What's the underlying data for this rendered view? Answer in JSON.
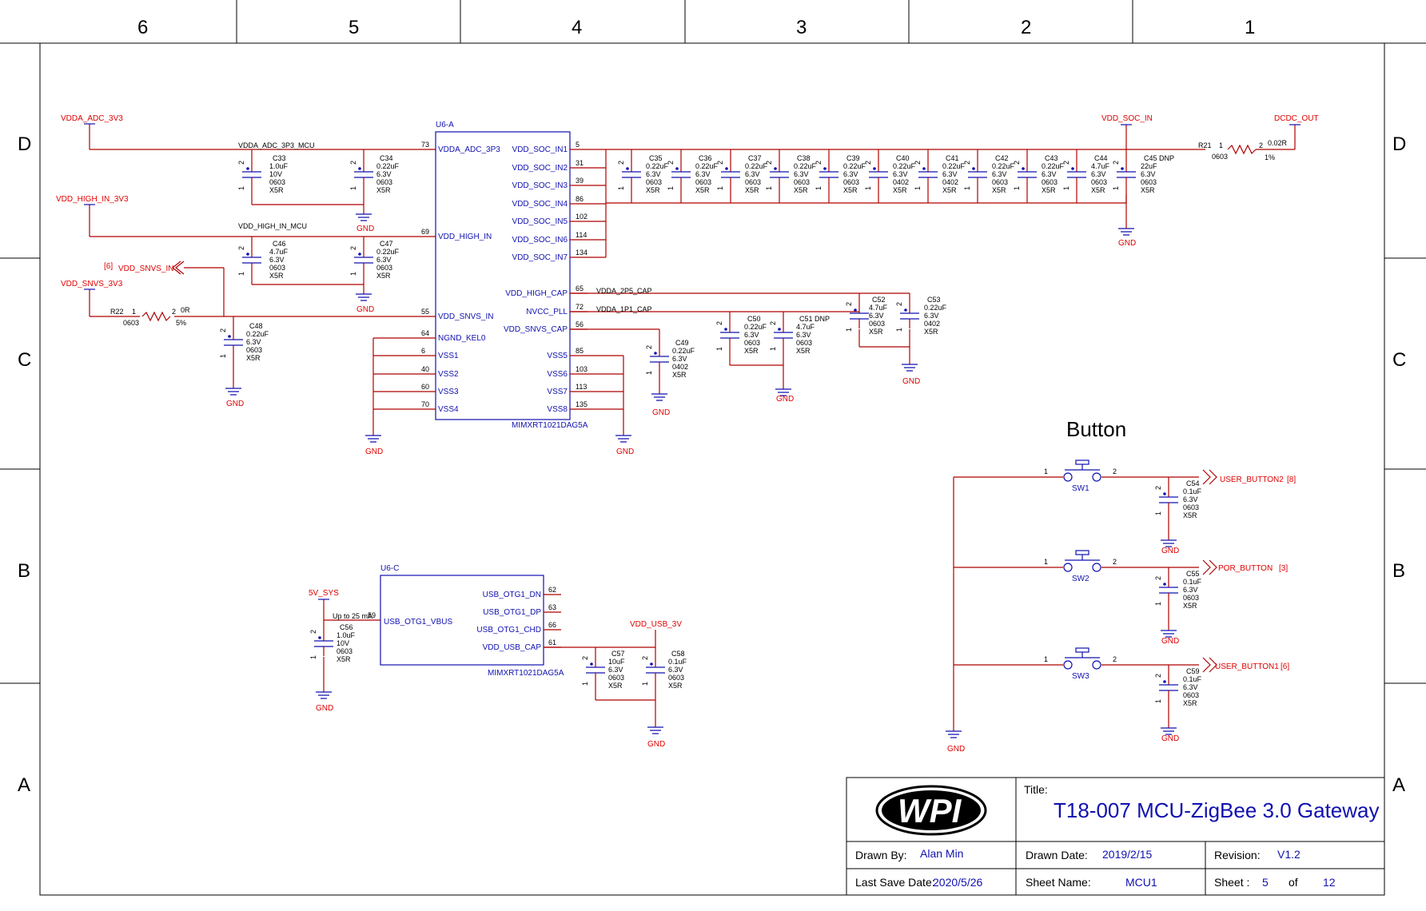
{
  "zones": {
    "columns": [
      "6",
      "5",
      "4",
      "3",
      "2",
      "1"
    ],
    "rows": [
      "D",
      "C",
      "B",
      "A"
    ]
  },
  "nets": {
    "vdda_adc": "VDDA_ADC_3V3",
    "vdda_adc_mcu": "VDDA_ADC_3P3_MCU",
    "vdd_high_in": "VDD_HIGH_IN_3V3",
    "vdd_high_in_mcu": "VDD_HIGH_IN_MCU",
    "vdd_snvs_in": "VDD_SNVS_IN",
    "vdd_snvs_in_ref": "[6]",
    "vdd_snvs_3v3": "VDD_SNVS_3V3",
    "vdd_soc_in": "VDD_SOC_IN",
    "dcdc_out": "DCDC_OUT",
    "vdda_2p5": "VDDA_2P5_CAP",
    "vdda_1p1": "VDDA_1P1_CAP",
    "v5_sys": "5V_SYS",
    "vdd_usb_3v": "VDD_USB_3V",
    "gnd": "GND",
    "user_button2": "USER_BUTTON2",
    "user_button2_ref": "[8]",
    "por_button": "POR_BUTTON",
    "por_button_ref": "[3]",
    "user_button1": "USER_BUTTON1",
    "user_button1_ref": "[6]",
    "usb_note": "Up to 25 mA"
  },
  "u6a": {
    "ref": "U6-A",
    "part": "MIMXRT1021DAG5A",
    "left_pins": [
      {
        "num": "73",
        "name": "VDDA_ADC_3P3"
      },
      {
        "num": "69",
        "name": "VDD_HIGH_IN"
      },
      {
        "num": "55",
        "name": "VDD_SNVS_IN"
      },
      {
        "num": "64",
        "name": "NGND_KEL0"
      },
      {
        "num": "6",
        "name": "VSS1"
      },
      {
        "num": "40",
        "name": "VSS2"
      },
      {
        "num": "60",
        "name": "VSS3"
      },
      {
        "num": "70",
        "name": "VSS4"
      }
    ],
    "right_pins": [
      {
        "num": "5",
        "name": "VDD_SOC_IN1"
      },
      {
        "num": "31",
        "name": "VDD_SOC_IN2"
      },
      {
        "num": "39",
        "name": "VDD_SOC_IN3"
      },
      {
        "num": "86",
        "name": "VDD_SOC_IN4"
      },
      {
        "num": "102",
        "name": "VDD_SOC_IN5"
      },
      {
        "num": "114",
        "name": "VDD_SOC_IN6"
      },
      {
        "num": "134",
        "name": "VDD_SOC_IN7"
      },
      {
        "num": "65",
        "name": "VDD_HIGH_CAP"
      },
      {
        "num": "72",
        "name": "NVCC_PLL"
      },
      {
        "num": "56",
        "name": "VDD_SNVS_CAP"
      },
      {
        "num": "85",
        "name": "VSS5"
      },
      {
        "num": "103",
        "name": "VSS6"
      },
      {
        "num": "113",
        "name": "VSS7"
      },
      {
        "num": "135",
        "name": "VSS8"
      }
    ]
  },
  "u6c": {
    "ref": "U6-C",
    "part": "MIMXRT1021DAG5A",
    "left_pins": [
      {
        "num": "59",
        "name": "USB_OTG1_VBUS"
      }
    ],
    "right_pins": [
      {
        "num": "62",
        "name": "USB_OTG1_DN"
      },
      {
        "num": "63",
        "name": "USB_OTG1_DP"
      },
      {
        "num": "66",
        "name": "USB_OTG1_CHD"
      },
      {
        "num": "61",
        "name": "VDD_USB_CAP"
      }
    ]
  },
  "caps_left": [
    {
      "ref": "C33",
      "val": "1.0uF",
      "v": "10V",
      "pkg": "0603",
      "d": "X5R"
    },
    {
      "ref": "C34",
      "val": "0.22uF",
      "v": "6.3V",
      "pkg": "0603",
      "d": "X5R"
    },
    {
      "ref": "C46",
      "val": "4.7uF",
      "v": "6.3V",
      "pkg": "0603",
      "d": "X5R"
    },
    {
      "ref": "C47",
      "val": "0.22uF",
      "v": "6.3V",
      "pkg": "0603",
      "d": "X5R"
    },
    {
      "ref": "C48",
      "val": "0.22uF",
      "v": "6.3V",
      "pkg": "0603",
      "d": "X5R"
    }
  ],
  "soc_caps": [
    {
      "ref": "C35",
      "val": "0.22uF",
      "v": "6.3V",
      "pkg": "0603",
      "d": "X5R"
    },
    {
      "ref": "C36",
      "val": "0.22uF",
      "v": "6.3V",
      "pkg": "0603",
      "d": "X5R"
    },
    {
      "ref": "C37",
      "val": "0.22uF",
      "v": "6.3V",
      "pkg": "0603",
      "d": "X5R"
    },
    {
      "ref": "C38",
      "val": "0.22uF",
      "v": "6.3V",
      "pkg": "0603",
      "d": "X5R"
    },
    {
      "ref": "C39",
      "val": "0.22uF",
      "v": "6.3V",
      "pkg": "0603",
      "d": "X5R"
    },
    {
      "ref": "C40",
      "val": "0.22uF",
      "v": "6.3V",
      "pkg": "0402",
      "d": "X5R"
    },
    {
      "ref": "C41",
      "val": "0.22uF",
      "v": "6.3V",
      "pkg": "0402",
      "d": "X5R"
    },
    {
      "ref": "C42",
      "val": "0.22uF",
      "v": "6.3V",
      "pkg": "0603",
      "d": "X5R"
    },
    {
      "ref": "C43",
      "val": "0.22uF",
      "v": "6.3V",
      "pkg": "0603",
      "d": "X5R"
    },
    {
      "ref": "C44",
      "val": "4.7uF",
      "v": "6.3V",
      "pkg": "0603",
      "d": "X5R"
    },
    {
      "ref": "C45 DNP",
      "val": "22uF",
      "v": "6.3V",
      "pkg": "0603",
      "d": "X5R"
    }
  ],
  "mid_caps": [
    {
      "ref": "C49",
      "val": "0.22uF",
      "v": "6.3V",
      "pkg": "0402",
      "d": "X5R"
    },
    {
      "ref": "C50",
      "val": "0.22uF",
      "v": "6.3V",
      "pkg": "0603",
      "d": "X5R"
    },
    {
      "ref": "C51 DNP",
      "val": "4.7uF",
      "v": "6.3V",
      "pkg": "0603",
      "d": "X5R"
    },
    {
      "ref": "C52",
      "val": "4.7uF",
      "v": "6.3V",
      "pkg": "0603",
      "d": "X5R"
    },
    {
      "ref": "C53",
      "val": "0.22uF",
      "v": "6.3V",
      "pkg": "0402",
      "d": "X5R"
    }
  ],
  "usb_caps": [
    {
      "ref": "C56",
      "val": "1.0uF",
      "v": "10V",
      "pkg": "0603",
      "d": "X5R"
    },
    {
      "ref": "C57",
      "val": "10uF",
      "v": "6.3V",
      "pkg": "0603",
      "d": "X5R"
    },
    {
      "ref": "C58",
      "val": "0.1uF",
      "v": "6.3V",
      "pkg": "0603",
      "d": "X5R"
    }
  ],
  "btn_caps": [
    {
      "ref": "C54",
      "val": "0.1uF",
      "v": "6.3V",
      "pkg": "0603",
      "d": "X5R"
    },
    {
      "ref": "C55",
      "val": "0.1uF",
      "v": "6.3V",
      "pkg": "0603",
      "d": "X5R"
    },
    {
      "ref": "C59",
      "val": "0.1uF",
      "v": "6.3V",
      "pkg": "0603",
      "d": "X5R"
    }
  ],
  "resistors": {
    "r21": {
      "ref": "R21",
      "val": "0.02R",
      "pkg": "0603",
      "tol": "1%"
    },
    "r22": {
      "ref": "R22",
      "val": "0R",
      "pkg": "0603",
      "tol": "5%"
    }
  },
  "buttons": {
    "heading": "Button",
    "switches": [
      "SW1",
      "SW2",
      "SW3"
    ]
  },
  "pin_nums": {
    "p1": "1",
    "p2": "2"
  },
  "title_block": {
    "title_label": "Title:",
    "title": "T18-007 MCU-ZigBee 3.0 Gateway",
    "logo_text": "WPI",
    "drawn_by_label": "Drawn By:",
    "drawn_by": "Alan Min",
    "drawn_date_label": "Drawn Date:",
    "drawn_date": "2019/2/15",
    "revision_label": "Revision:",
    "revision": "V1.2",
    "last_save_label": "Last Save Date:",
    "last_save": "2020/5/26",
    "sheet_name_label": "Sheet Name:",
    "sheet_name": "MCU1",
    "sheet_label": "Sheet :",
    "sheet": "5",
    "of_label": "of",
    "total": "12"
  }
}
